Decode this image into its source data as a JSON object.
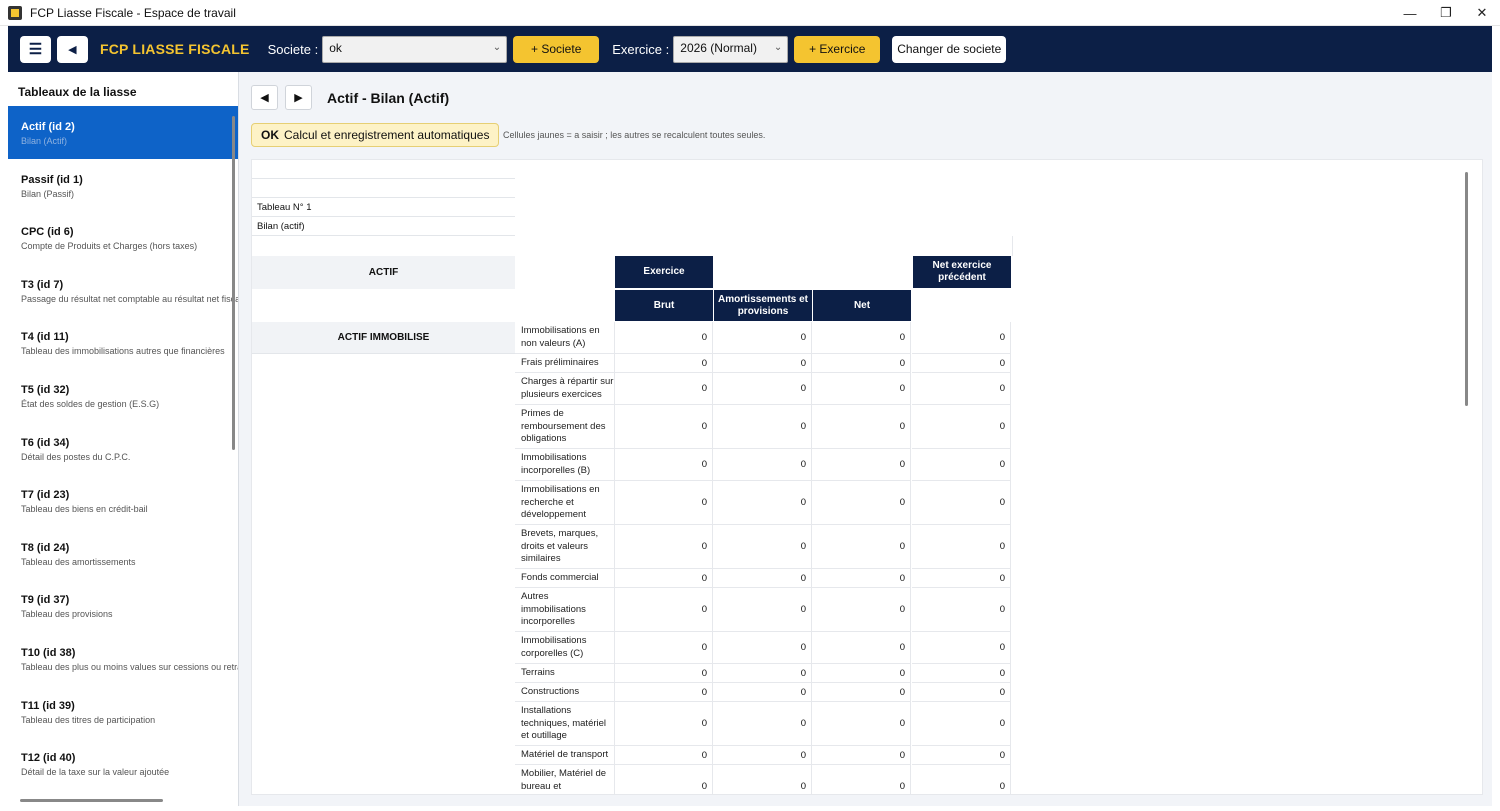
{
  "window": {
    "title": "FCP Liasse Fiscale - Espace de travail",
    "controls": [
      "—",
      "❐",
      "✕"
    ]
  },
  "topbar": {
    "menu_icon": "☰",
    "back_icon": "◂",
    "brand": "FCP LIASSE FISCALE",
    "societe_label": "Societe :",
    "societe_value": "ok",
    "add_societe": "+ Societe",
    "exercice_label": "Exercice :",
    "exercice_value": "2026 (Normal)",
    "add_exercice": "+ Exercice",
    "change_societe": "Changer de societe"
  },
  "sidebar": {
    "title": "Tableaux de la liasse",
    "items": [
      {
        "name": "Actif  (id 2)",
        "sub": "Bilan (Actif)",
        "active": true
      },
      {
        "name": "Passif  (id 1)",
        "sub": "Bilan (Passif)"
      },
      {
        "name": "CPC  (id 6)",
        "sub": "Compte de Produits et Charges (hors taxes)"
      },
      {
        "name": "T3  (id 7)",
        "sub": "Passage du résultat net comptable au résultat net fiscal"
      },
      {
        "name": "T4  (id 11)",
        "sub": "Tableau des immobilisations autres que financières"
      },
      {
        "name": "T5  (id 32)",
        "sub": "État des soldes de gestion (E.S.G)"
      },
      {
        "name": "T6  (id 34)",
        "sub": "Détail des postes du C.P.C."
      },
      {
        "name": "T7  (id 23)",
        "sub": "Tableau des biens en crédit-bail"
      },
      {
        "name": "T8  (id 24)",
        "sub": "Tableau des amortissements"
      },
      {
        "name": "T9  (id 37)",
        "sub": "Tableau des provisions"
      },
      {
        "name": "T10  (id 38)",
        "sub": "Tableau des plus ou moins values sur cessions ou retraits d"
      },
      {
        "name": "T11  (id 39)",
        "sub": "Tableau des titres de participation"
      },
      {
        "name": "T12  (id 40)",
        "sub": "Détail de la taxe sur la valeur ajoutée"
      }
    ]
  },
  "main": {
    "prev_icon": "◀",
    "next_icon": "▶",
    "title": "Actif - Bilan (Actif)",
    "ok_tag": "OK",
    "ok_text": "Calcul et enregistrement automatiques",
    "hint": "Cellules jaunes = a saisir ; les autres se recalculent toutes seules."
  },
  "sheet": {
    "tableau_no": "Tableau N° 1",
    "tableau_name": "Bilan (actif)",
    "actif_header": "ACTIF",
    "section": "ACTIF IMMOBILISE",
    "col_exercice": "Exercice",
    "col_prev": "Net exercice précédent",
    "col_brut": "Brut",
    "col_amort": "Amortissements et provisions",
    "col_net": "Net",
    "rows": [
      {
        "label": "Immobilisations en non valeurs (A)",
        "values": [
          "0",
          "0",
          "0",
          "0"
        ]
      },
      {
        "label": "Frais préliminaires",
        "values": [
          "0",
          "0",
          "0",
          "0"
        ]
      },
      {
        "label": "Charges à répartir sur plusieurs exercices",
        "values": [
          "0",
          "0",
          "0",
          "0"
        ]
      },
      {
        "label": "Primes de remboursement des obligations",
        "values": [
          "0",
          "0",
          "0",
          "0"
        ]
      },
      {
        "label": "Immobilisations incorporelles (B)",
        "values": [
          "0",
          "0",
          "0",
          "0"
        ]
      },
      {
        "label": "Immobilisations en recherche et développement",
        "values": [
          "0",
          "0",
          "0",
          "0"
        ]
      },
      {
        "label": "Brevets, marques, droits et valeurs similaires",
        "values": [
          "0",
          "0",
          "0",
          "0"
        ]
      },
      {
        "label": "Fonds commercial",
        "values": [
          "0",
          "0",
          "0",
          "0"
        ]
      },
      {
        "label": "Autres immobilisations incorporelles",
        "values": [
          "0",
          "0",
          "0",
          "0"
        ]
      },
      {
        "label": "Immobilisations corporelles (C)",
        "values": [
          "0",
          "0",
          "0",
          "0"
        ]
      },
      {
        "label": "Terrains",
        "values": [
          "0",
          "0",
          "0",
          "0"
        ]
      },
      {
        "label": "Constructions",
        "values": [
          "0",
          "0",
          "0",
          "0"
        ]
      },
      {
        "label": "Installations techniques, matériel et outillage",
        "values": [
          "0",
          "0",
          "0",
          "0"
        ]
      },
      {
        "label": "Matériel de transport",
        "values": [
          "0",
          "0",
          "0",
          "0"
        ]
      },
      {
        "label": "Mobilier, Matériel de bureau et",
        "values": [
          "0",
          "0",
          "0",
          "0"
        ]
      }
    ]
  }
}
